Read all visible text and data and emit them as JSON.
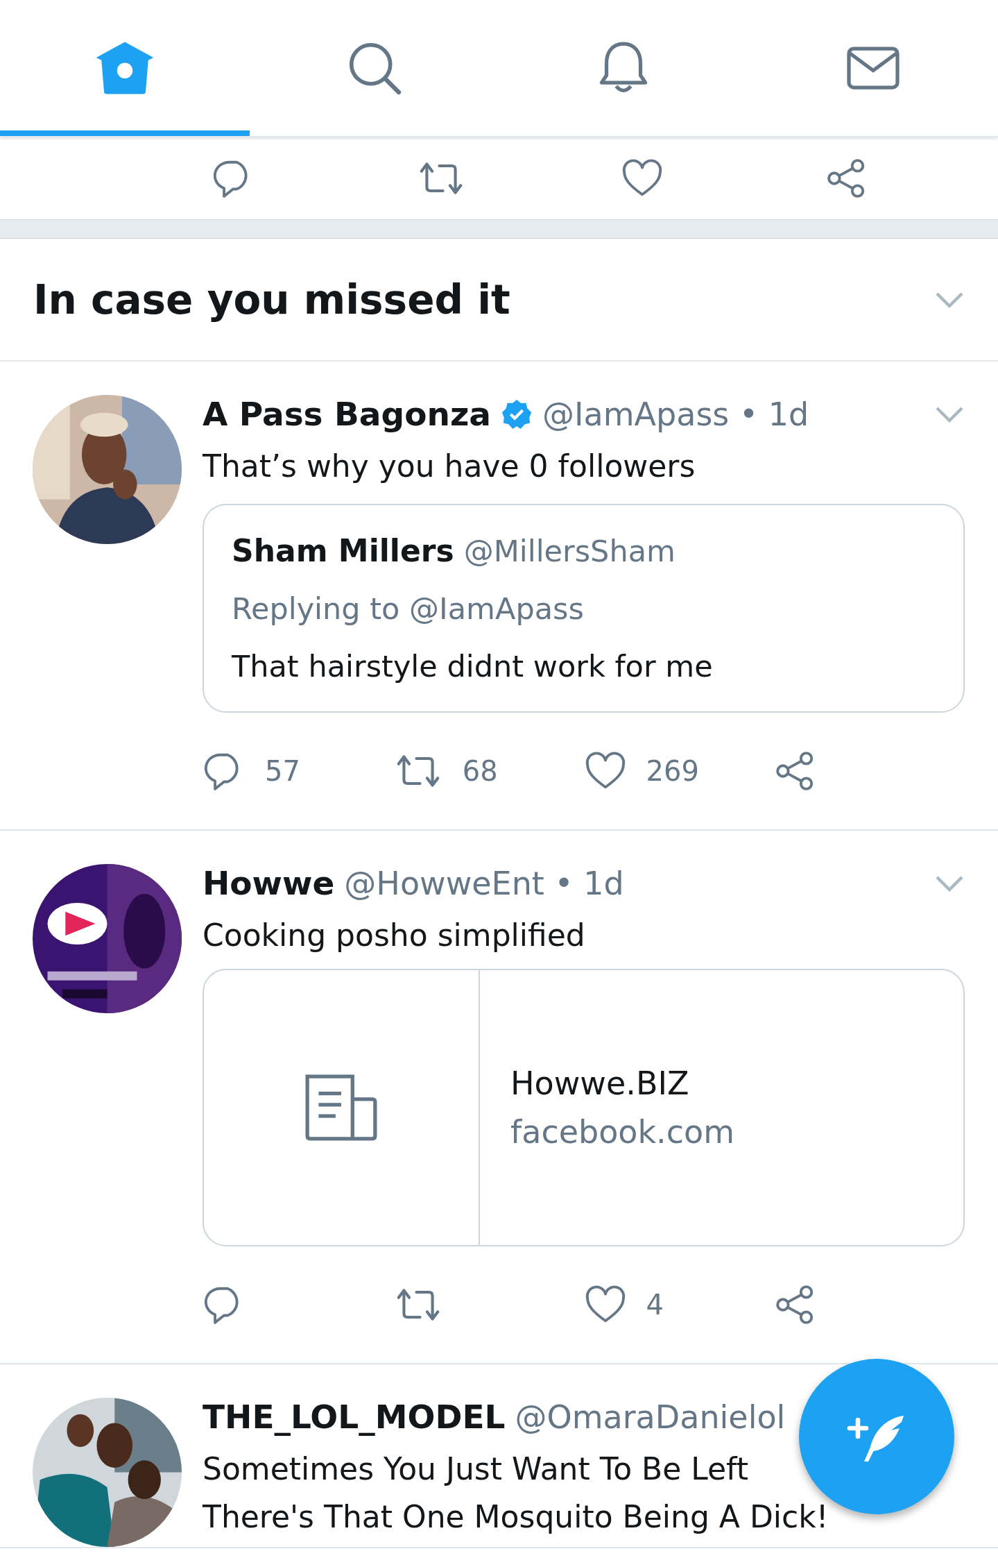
{
  "tabs": [
    {
      "kind": "home",
      "selected": true
    },
    {
      "kind": "search",
      "selected": false
    },
    {
      "kind": "bell",
      "selected": false
    },
    {
      "kind": "mail",
      "selected": false
    }
  ],
  "partial_tweet": {
    "actions": [
      {
        "kind": "reply"
      },
      {
        "kind": "retweet"
      },
      {
        "kind": "like"
      },
      {
        "kind": "share"
      }
    ]
  },
  "section": {
    "title": "In case you missed it"
  },
  "tweets": [
    {
      "name": "A Pass Bagonza",
      "menu": true,
      "verified": true,
      "meta": "@IamApass • 1d",
      "text": [
        "That’s why you have 0 followers"
      ],
      "card": {
        "kind": "quote",
        "name": "Sham Millers",
        "handle": "@MillersSham",
        "reply": "Replying to @IamApass",
        "text": "That hairstyle didnt work for me"
      },
      "actions": [
        {
          "kind": "reply",
          "count": "57"
        },
        {
          "kind": "retweet",
          "count": "68"
        },
        {
          "kind": "like",
          "count": "269"
        },
        {
          "kind": "share"
        }
      ]
    },
    {
      "name": "Howwe",
      "menu": true,
      "verified": false,
      "meta": "@HowweEnt • 1d",
      "text": [
        "Cooking posho simplified"
      ],
      "card": {
        "kind": "link",
        "title": "Howwe.BIZ",
        "domain": "facebook.com"
      },
      "actions": [
        {
          "kind": "reply"
        },
        {
          "kind": "retweet"
        },
        {
          "kind": "like",
          "count": "4"
        },
        {
          "kind": "share"
        }
      ]
    },
    {
      "name": "THE_LOL_MODEL",
      "menu": false,
      "verified": false,
      "meta": "@OmaraDanielol",
      "text": [
        "Sometimes You Just Want To Be Left",
        "There's That One Mosquito Being A Dick!"
      ]
    }
  ]
}
